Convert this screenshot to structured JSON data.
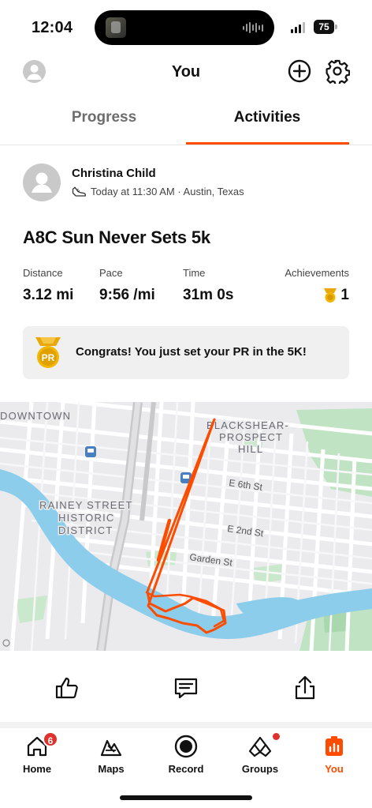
{
  "status_bar": {
    "time": "12:04",
    "battery": "75"
  },
  "header": {
    "title": "You"
  },
  "tabs": [
    {
      "label": "Progress"
    },
    {
      "label": "Activities"
    }
  ],
  "activity": {
    "athlete": "Christina Child",
    "meta": "Today at 11:30 AM · Austin, Texas",
    "title": "A8C Sun Never Sets 5k",
    "stats": {
      "distance": {
        "label": "Distance",
        "value": "3.12 mi"
      },
      "pace": {
        "label": "Pace",
        "value": "9:56 /mi"
      },
      "time": {
        "label": "Time",
        "value": "31m 0s"
      },
      "achievements": {
        "label": "Achievements",
        "value": "1"
      }
    },
    "pr_banner": {
      "badge": "PR",
      "text": "Congrats! You just set your PR in the 5K!"
    }
  },
  "map": {
    "labels": {
      "downtown": "DOWNTOWN",
      "blackshear_1": "BLACKSHEAR-",
      "blackshear_2": "PROSPECT",
      "blackshear_3": "HILL",
      "rainey_1": "RAINEY STREET",
      "rainey_2": "HISTORIC",
      "rainey_3": "DISTRICT",
      "e6th": "E 6th St",
      "e2nd": "E 2nd St",
      "garden": "Garden St"
    },
    "route_color": "#fc4c02"
  },
  "nav": {
    "home": {
      "label": "Home",
      "badge": "6"
    },
    "maps": {
      "label": "Maps"
    },
    "record": {
      "label": "Record"
    },
    "groups": {
      "label": "Groups"
    },
    "you": {
      "label": "You"
    }
  },
  "colors": {
    "accent": "#fc4c02",
    "badge": "#e0322c"
  }
}
